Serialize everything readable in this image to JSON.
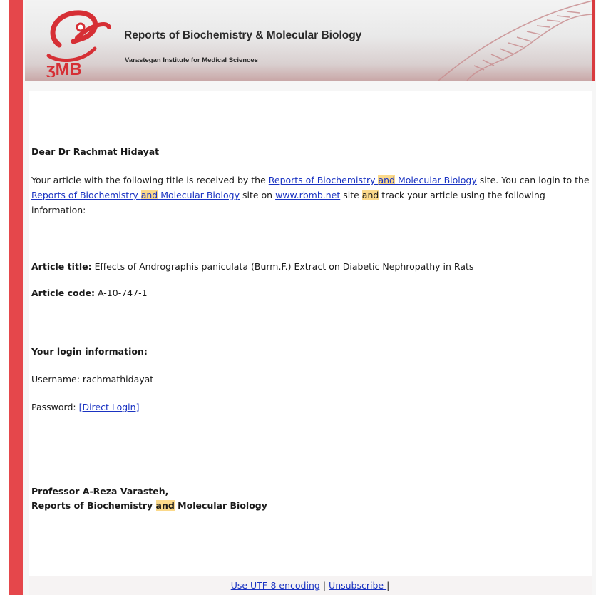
{
  "banner": {
    "title": "Reports of Biochemistry & Molecular Biology",
    "subtitle": "Varastegan Institute for Medical Sciences",
    "logo_text": "RBMB"
  },
  "email": {
    "greeting": "Dear Dr Rachmat Hidayat",
    "intro": {
      "p1": "Your article with the following title is received by the ",
      "journal_part1": "Reports of Biochemistry ",
      "journal_and": "and",
      "journal_part2": " Molecular Biology",
      "p2": " site. You can login to the ",
      "p3": " site on ",
      "site_url": "www.rbmb.net",
      "p4": " site ",
      "and_word": "and",
      "p5": " track your article using the following information:"
    },
    "article_title_label": "Article title:",
    "article_title_value": " Effects of Andrographis paniculata (Burm.F.) Extract on Diabetic Nephropathy in Rats",
    "article_code_label": "Article code:",
    "article_code_value": " A-10-747-1",
    "login_heading": "Your login information:",
    "username_line": "Username: rachmathidayat",
    "password_label": "Password: ",
    "direct_login_link": "[Direct Login]",
    "divider": "----------------------------",
    "signature_name": "Professor A-Reza Varasteh,",
    "signature_org_part1": "Reports of Biochemistry ",
    "signature_org_and": "and",
    "signature_org_part2": " Molecular Biology"
  },
  "footer": {
    "encoding_link": "Use UTF-8 encoding",
    "separator": "|",
    "unsubscribe_link": "Unsubscribe ",
    "trailing_separator": "|"
  },
  "colors": {
    "accent_red": "#e5474b",
    "link_blue": "#1a33c2",
    "highlight": "#fbd98a"
  }
}
